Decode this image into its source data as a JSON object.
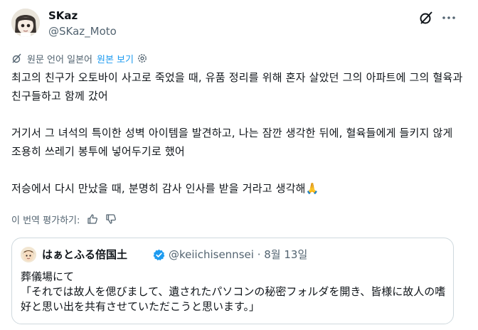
{
  "author": {
    "display_name": "SKaz",
    "handle": "@SKaz_Moto",
    "avatar_icon": "anime-avatar"
  },
  "header_icons": {
    "grok": "grok-icon",
    "more": "more-dots-icon"
  },
  "translation_bar": {
    "translated_from": "원문 언어 일본어",
    "show_original": "원본 보기",
    "settings_icon": "gear-icon",
    "translate_icon": "translate-icon"
  },
  "post": {
    "paragraphs": [
      "최고의 친구가 오토바이 사고로 죽었을 때, 유품 정리를 위해 혼자 살았던 그의 아파트에 그의 혈육과 친구들하고 함께 갔어",
      "거기서 그 녀석의 특이한 성벽 아이템을 발견하고, 나는 잠깐 생각한 뒤에, 혈육들에게 들키지 않게 조용히 쓰레기 봉투에 넣어두기로 했어",
      "저승에서 다시 만났을 때, 분명히 감사 인사를 받을 거라고 생각해🙏"
    ]
  },
  "rating": {
    "label": "이 번역 평가하기:",
    "thumbs_up_icon": "thumbs-up-icon",
    "thumbs_down_icon": "thumbs-down-icon"
  },
  "quoted_post": {
    "display_name": "はぁとふる倍国土",
    "verified_icon": "verified-badge-icon",
    "handle": "@keiichisennsei",
    "separator": "·",
    "date": "8월 13일",
    "lines": [
      "葬儀場にて",
      "「それでは故人を偲びまして、遺されたパソコンの秘密フォルダを開き、皆様に故人の嗜好と思い出を共有させていただこうと思います。」"
    ]
  },
  "colors": {
    "text": "#0f1419",
    "secondary": "#536471",
    "accent": "#1d9bf0",
    "border": "#cfd9de"
  }
}
